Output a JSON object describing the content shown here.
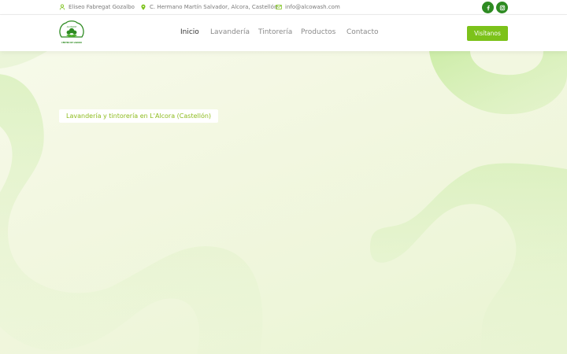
{
  "topbar": {
    "name": "Eliseo Fabregat Gozalbo",
    "address": "C. Hermano Martín Salvador, Alcora, Castellón",
    "email": "info@alcowash.com",
    "social": [
      "facebook-icon",
      "instagram-icon"
    ]
  },
  "logo": {
    "top_text": "ALCOWASH",
    "bottom_text": "CENTRO DE LAVADO"
  },
  "nav": {
    "items": [
      "Inicio",
      "Lavandería",
      "Tintorería",
      "Productos",
      "Contacto"
    ],
    "active": "Inicio"
  },
  "cta": {
    "label": "Visítanos"
  },
  "hero": {
    "tagline": "Lavandería y tintorería en L'Alcora (Castellón)"
  },
  "colors": {
    "accent": "#7cc21a",
    "dark_green": "#2e8b22",
    "tagline": "#8dbb1e"
  }
}
